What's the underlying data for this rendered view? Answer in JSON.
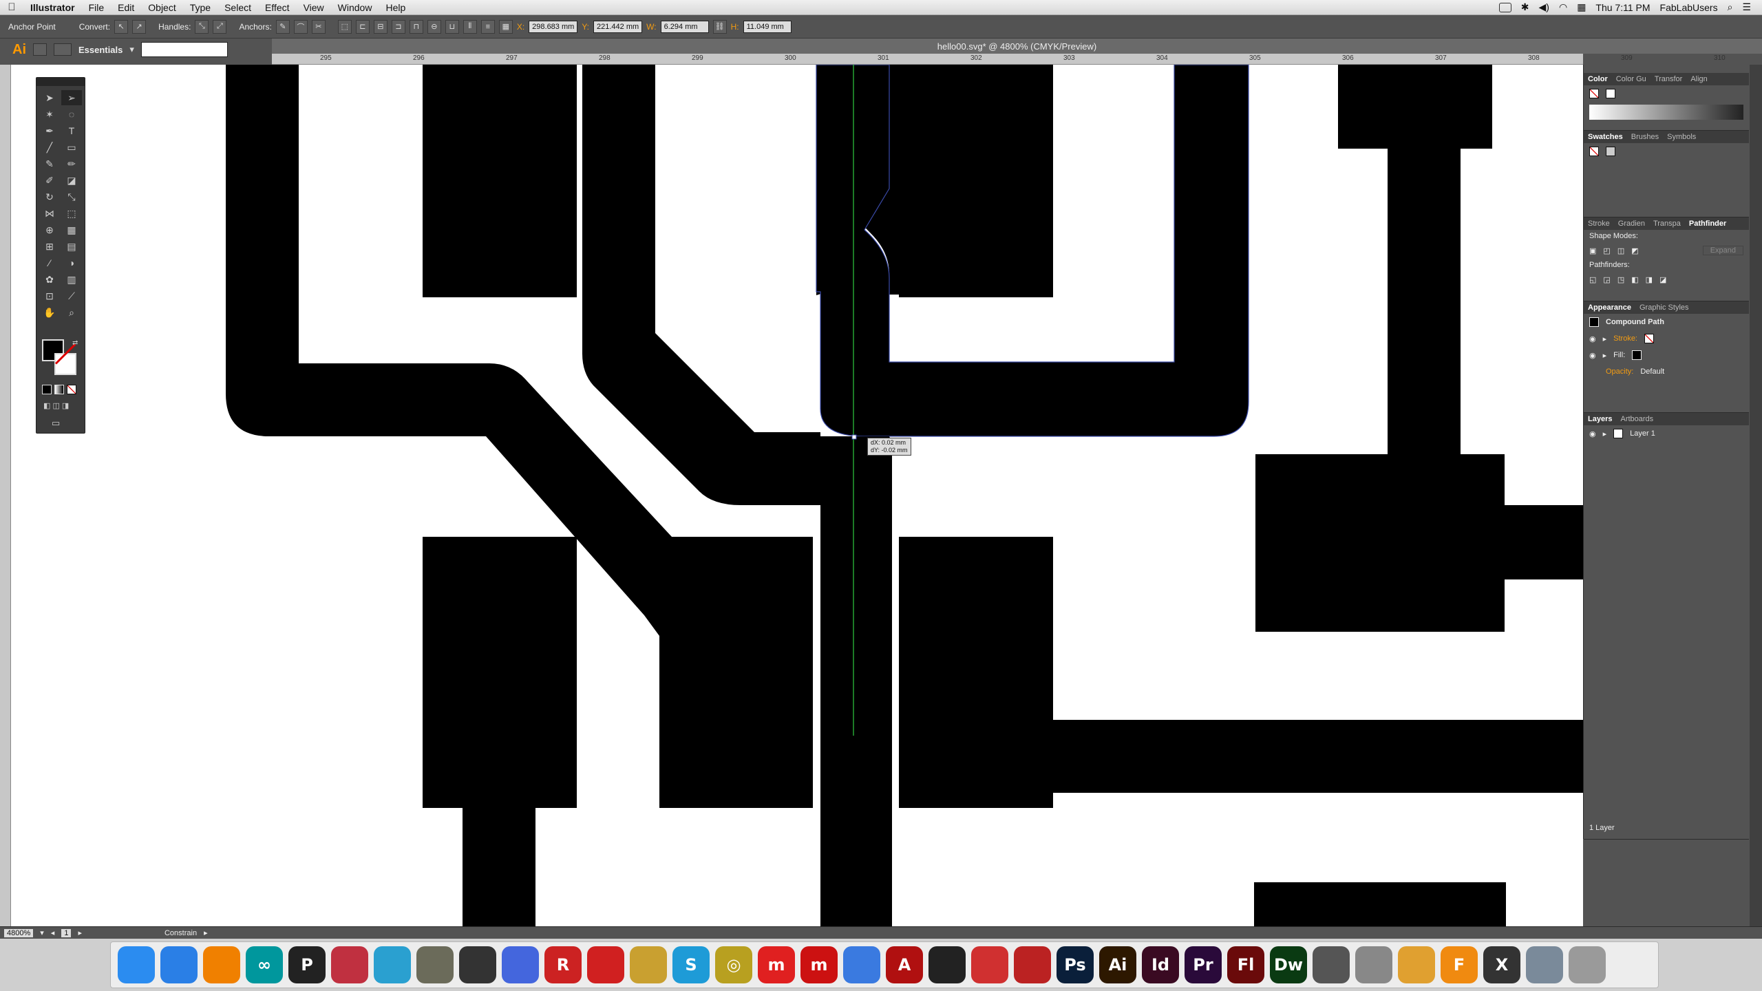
{
  "menubar": {
    "app": "Illustrator",
    "menus": [
      "File",
      "Edit",
      "Object",
      "Type",
      "Select",
      "Effect",
      "View",
      "Window",
      "Help"
    ],
    "clock": "Thu 7:11 PM",
    "user": "FabLabUsers"
  },
  "controlbar": {
    "tool_name": "Anchor Point",
    "convert_label": "Convert:",
    "handles_label": "Handles:",
    "anchors_label": "Anchors:",
    "x_label": "X:",
    "x_value": "298.683 mm",
    "y_label": "Y:",
    "y_value": "221.442 mm",
    "w_label": "W:",
    "w_value": "6.294 mm",
    "h_label": "H:",
    "h_value": "11.049 mm"
  },
  "appbar": {
    "logo": "Ai",
    "workspace": "Essentials",
    "search_placeholder": ""
  },
  "document": {
    "tab_title": "hello00.svg* @ 4800% (CMYK/Preview)",
    "ruler_ticks": [
      "295",
      "296",
      "297",
      "298",
      "299",
      "300",
      "301",
      "302",
      "303",
      "304",
      "305",
      "306",
      "307",
      "308",
      "309",
      "310"
    ]
  },
  "tooltip": {
    "dx": "dX: 0.02 mm",
    "dy": "dY: -0.02 mm"
  },
  "panels": {
    "color_tabs": [
      "Color",
      "Color Gu",
      "Transfor",
      "Align"
    ],
    "swatch_tabs": [
      "Swatches",
      "Brushes",
      "Symbols"
    ],
    "pathfinder_tabs": [
      "Stroke",
      "Gradien",
      "Transpa",
      "Pathfinder"
    ],
    "shape_modes_label": "Shape Modes:",
    "expand_label": "Expand",
    "pathfinders_label": "Pathfinders:",
    "appearance_tabs": [
      "Appearance",
      "Graphic Styles"
    ],
    "appearance_title": "Compound Path",
    "stroke_label": "Stroke:",
    "fill_label": "Fill:",
    "opacity_label": "Opacity:",
    "opacity_value": "Default",
    "layers_tabs": [
      "Layers",
      "Artboards"
    ],
    "layer_name": "Layer 1",
    "layer_count": "1 Layer"
  },
  "statusbar": {
    "zoom": "4800%",
    "artboard": "1",
    "mode": "Constrain"
  },
  "dock": {
    "icons": [
      {
        "name": "finder-icon",
        "label": "",
        "color": "#2b8cf0"
      },
      {
        "name": "safari-icon",
        "label": "",
        "color": "#2a7fe6"
      },
      {
        "name": "vlc-icon",
        "label": "",
        "color": "#f08000"
      },
      {
        "name": "arduino-icon",
        "label": "∞",
        "color": "#00979d"
      },
      {
        "name": "processing-icon",
        "label": "P",
        "color": "#222"
      },
      {
        "name": "3d-app-icon",
        "label": "",
        "color": "#c03040"
      },
      {
        "name": "vector-app-icon",
        "label": "",
        "color": "#2aa0d0"
      },
      {
        "name": "gimp-icon",
        "label": "",
        "color": "#6b6b5a"
      },
      {
        "name": "inkscape-icon",
        "label": "",
        "color": "#333"
      },
      {
        "name": "modeling-app-icon",
        "label": "",
        "color": "#4466dd"
      },
      {
        "name": "roland-icon",
        "label": "R",
        "color": "#cc2222"
      },
      {
        "name": "autodesk-icon",
        "label": "",
        "color": "#d02020"
      },
      {
        "name": "cheese-app-icon",
        "label": "",
        "color": "#c9a030"
      },
      {
        "name": "sketch-app-icon",
        "label": "S",
        "color": "#1e9bd7"
      },
      {
        "name": "target-app-icon",
        "label": "◎",
        "color": "#b8a020"
      },
      {
        "name": "makerbot-icon",
        "label": "m",
        "color": "#e02020"
      },
      {
        "name": "makerware-icon",
        "label": "m",
        "color": "#cc1111"
      },
      {
        "name": "appstore-icon",
        "label": "",
        "color": "#3a7ae0"
      },
      {
        "name": "autocad-icon",
        "label": "A",
        "color": "#b01010"
      },
      {
        "name": "cut-app-icon",
        "label": "",
        "color": "#222"
      },
      {
        "name": "sketchup-icon",
        "label": "",
        "color": "#d03030"
      },
      {
        "name": "cnc-app-icon",
        "label": "",
        "color": "#bb2222"
      },
      {
        "name": "photoshop-icon",
        "label": "Ps",
        "color": "#0a1f3a"
      },
      {
        "name": "illustrator-icon",
        "label": "Ai",
        "color": "#2d1800"
      },
      {
        "name": "indesign-icon",
        "label": "Id",
        "color": "#3a0a22"
      },
      {
        "name": "premiere-icon",
        "label": "Pr",
        "color": "#2a0a3a"
      },
      {
        "name": "flash-icon",
        "label": "Fl",
        "color": "#6a0a0a"
      },
      {
        "name": "dreamweaver-icon",
        "label": "Dw",
        "color": "#0a3a12"
      },
      {
        "name": "calculator-icon",
        "label": "",
        "color": "#555"
      },
      {
        "name": "preview-icon",
        "label": "",
        "color": "#888"
      },
      {
        "name": "photos-icon",
        "label": "",
        "color": "#e0a030"
      },
      {
        "name": "fusion360-icon",
        "label": "F",
        "color": "#f08a10"
      },
      {
        "name": "x11-icon",
        "label": "X",
        "color": "#333"
      },
      {
        "name": "downloads-icon",
        "label": "",
        "color": "#7a8a9a"
      },
      {
        "name": "trash-icon",
        "label": "",
        "color": "#9a9a9a"
      }
    ]
  }
}
